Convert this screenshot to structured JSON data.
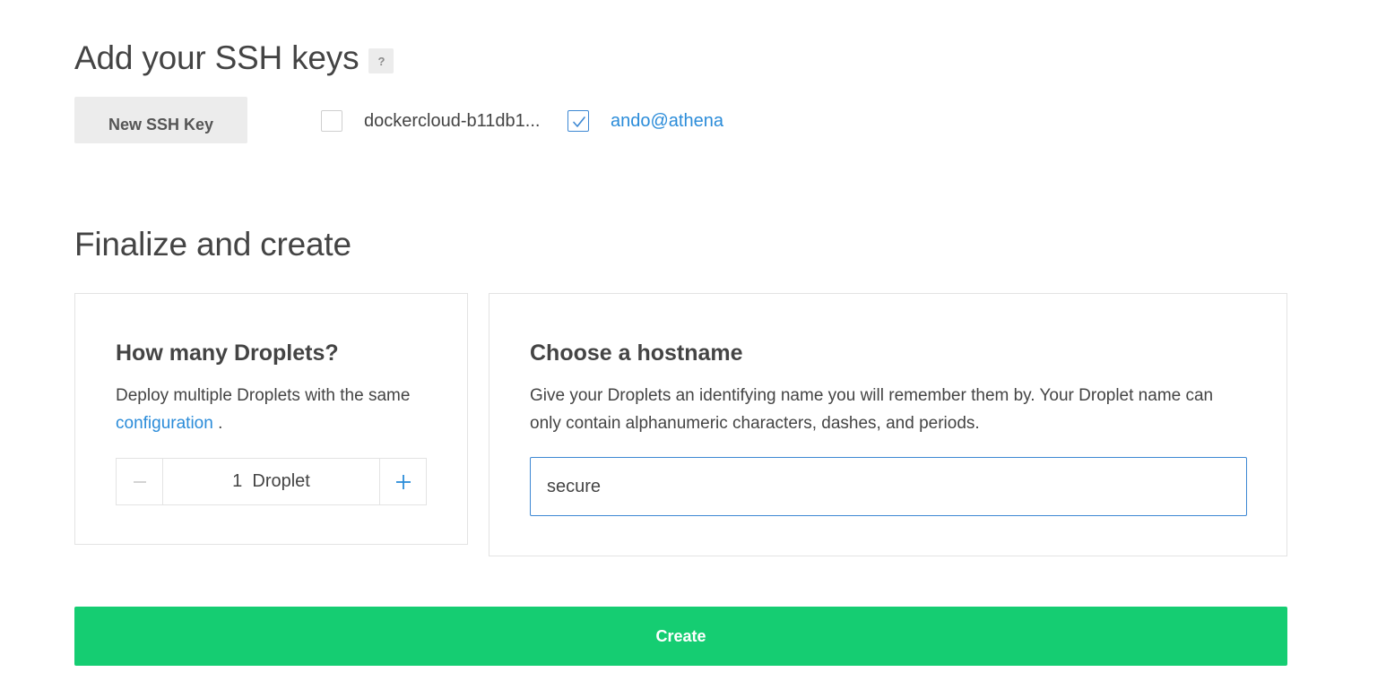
{
  "ssh": {
    "title": "Add your SSH keys",
    "help_label": "?",
    "new_key_button": "New SSH Key",
    "keys": [
      {
        "label": "dockercloud-b11db1...",
        "checked": false
      },
      {
        "label": "ando@athena",
        "checked": true
      }
    ]
  },
  "finalize": {
    "title": "Finalize and create",
    "droplets": {
      "title": "How many Droplets?",
      "desc_before": "Deploy multiple Droplets with the same ",
      "desc_link": "configuration",
      "desc_after": " .",
      "count": "1",
      "unit": "Droplet"
    },
    "hostname": {
      "title": "Choose a hostname",
      "desc": "Give your Droplets an identifying name you will remember them by. Your Droplet name can only contain alphanumeric characters, dashes, and periods.",
      "value": "secure"
    },
    "create_button": "Create"
  },
  "colors": {
    "accent_blue": "#2b8cd9",
    "create_green": "#15cd72",
    "text": "#444444"
  },
  "icons": {
    "minus": "minus-icon",
    "plus": "plus-icon",
    "check": "check-icon"
  }
}
